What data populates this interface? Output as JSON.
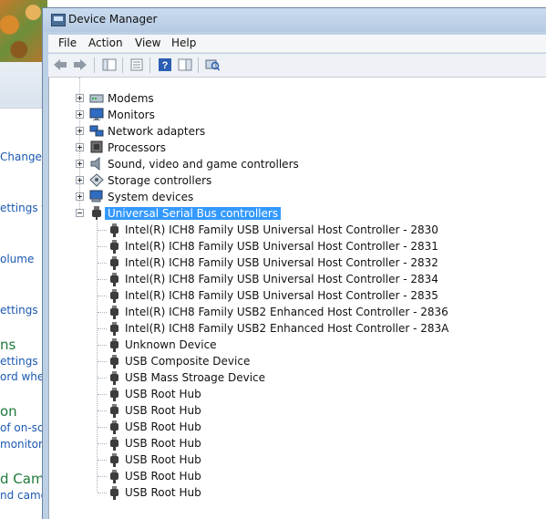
{
  "window": {
    "title": "Device Manager"
  },
  "menu": {
    "file": "File",
    "action": "Action",
    "view": "View",
    "help": "Help"
  },
  "toolbar": {
    "buttons": [
      "back-icon",
      "forward-icon",
      "show-hide-console-tree-icon",
      "properties-icon",
      "help-icon",
      "action-pane-icon",
      "scan-hardware-changes-icon"
    ]
  },
  "background_window": {
    "items": [
      "Change",
      "ettings f",
      "olume",
      "ettings",
      "ns",
      "ettings",
      "ord when",
      "on",
      "of on-scre",
      "monitor fo",
      "d Came",
      "nd camer"
    ]
  },
  "tree": {
    "categories": [
      {
        "label": "Modems",
        "icon": "modem-icon"
      },
      {
        "label": "Monitors",
        "icon": "monitor-icon"
      },
      {
        "label": "Network adapters",
        "icon": "network-adapter-icon"
      },
      {
        "label": "Processors",
        "icon": "processor-icon"
      },
      {
        "label": "Sound, video and game controllers",
        "icon": "speaker-icon"
      },
      {
        "label": "Storage controllers",
        "icon": "storage-controller-icon"
      },
      {
        "label": "System devices",
        "icon": "system-devices-icon"
      },
      {
        "label": "Universal Serial Bus controllers",
        "icon": "usb-plug-icon"
      }
    ],
    "usb_devices": [
      "Intel(R) ICH8 Family USB Universal Host Controller - 2830",
      "Intel(R) ICH8 Family USB Universal Host Controller - 2831",
      "Intel(R) ICH8 Family USB Universal Host Controller - 2832",
      "Intel(R) ICH8 Family USB Universal Host Controller - 2834",
      "Intel(R) ICH8 Family USB Universal Host Controller - 2835",
      "Intel(R) ICH8 Family USB2 Enhanced Host Controller - 2836",
      "Intel(R) ICH8 Family USB2 Enhanced Host Controller - 283A",
      "Unknown Device",
      "USB Composite Device",
      "USB Mass Stroage Device",
      "USB Root Hub",
      "USB Root Hub",
      "USB Root Hub",
      "USB Root Hub",
      "USB Root Hub",
      "USB Root Hub",
      "USB Root Hub"
    ]
  }
}
